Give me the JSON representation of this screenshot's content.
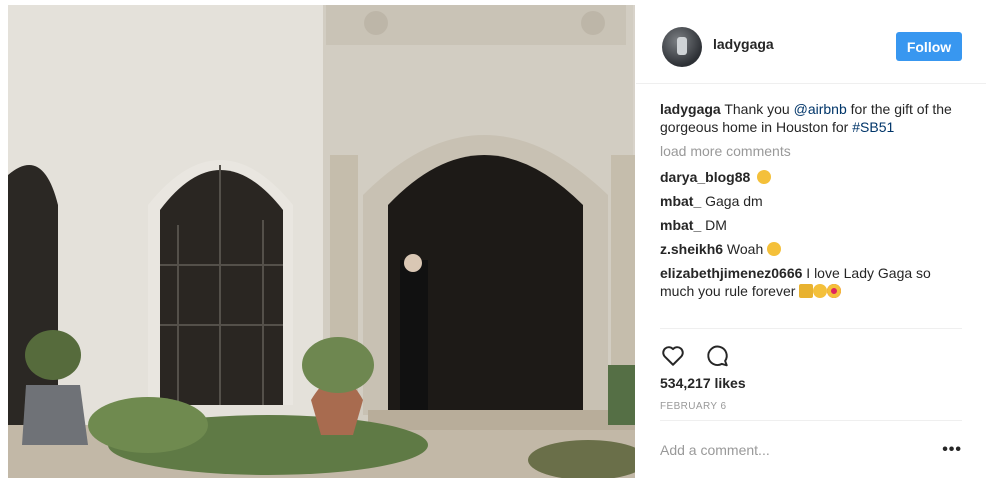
{
  "post": {
    "username": "ladygaga",
    "follow_label": "Follow",
    "caption": {
      "user": "ladygaga",
      "text_1": " Thank you ",
      "mention": "@airbnb",
      "text_2": " for the gift of the gorgeous home in Houston for ",
      "hashtag": "#SB51"
    },
    "load_more": "load more comments",
    "comments": [
      {
        "user": "darya_blog88",
        "text": "",
        "emoji": "surprised-face"
      },
      {
        "user": "mbat_",
        "text": " Gaga dm"
      },
      {
        "user": "mbat_",
        "text": " DM"
      },
      {
        "user": "z.sheikh6",
        "text": " Woah ",
        "emoji": "grimacing-face"
      },
      {
        "user": "elizabethjimenez0666",
        "text": " I love Lady Gaga so much you rule forever ",
        "emoji": "crown-angel-heart-eyes"
      }
    ],
    "likes": "534,217 likes",
    "date": "FEBRUARY 6",
    "add_comment_placeholder": "Add a comment...",
    "more_label": "•••",
    "colors": {
      "follow": "#3897f0",
      "link": "#003569",
      "muted": "#999999"
    },
    "icons": [
      "heart-icon",
      "comment-icon"
    ]
  }
}
